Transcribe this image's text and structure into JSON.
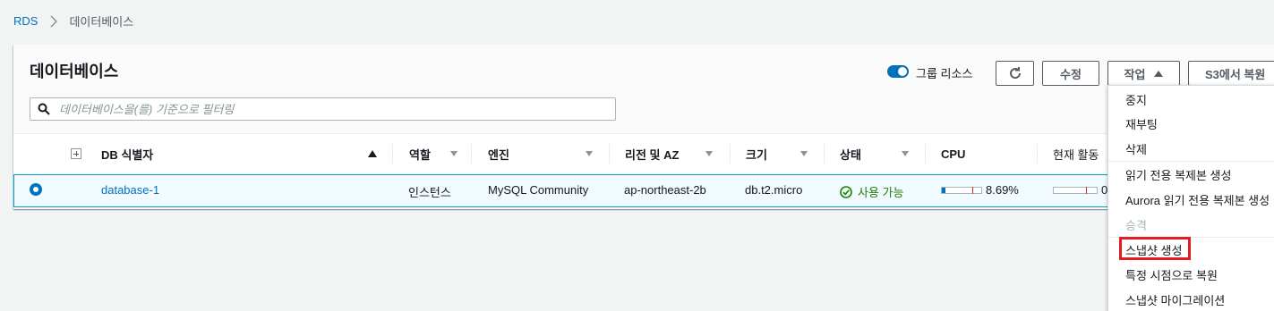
{
  "breadcrumb": {
    "root": "RDS",
    "current": "데이터베이스"
  },
  "panel": {
    "title": "데이터베이스",
    "group_toggle_label": "그룹 리소스",
    "buttons": {
      "edit": "수정",
      "actions": "작업",
      "restore_s3": "S3에서 복원"
    },
    "search_placeholder": "데이터베이스을(를) 기준으로 필터링"
  },
  "table": {
    "headers": {
      "db_identifier": "DB 식별자",
      "role": "역할",
      "engine": "엔진",
      "region": "리전 및 AZ",
      "size": "크기",
      "status": "상태",
      "cpu": "CPU",
      "activity": "현재 활동"
    },
    "rows": [
      {
        "db_identifier": "database-1",
        "role": "인스턴스",
        "engine": "MySQL Community",
        "region": "ap-northeast-2b",
        "size": "db.t2.micro",
        "status": "사용 가능",
        "cpu": "8.69%",
        "cpu_value": 8.69,
        "activity": "0"
      }
    ]
  },
  "actions_menu": {
    "items": [
      "중지",
      "재부팅",
      "삭제",
      "읽기 전용 복제본 생성",
      "Aurora 읽기 전용 복제본 생성",
      "승격",
      "스냅샷 생성",
      "특정 시점으로 복원",
      "스냅샷 마이그레이션"
    ],
    "disabled": [
      "승격"
    ],
    "highlighted": "스냅샷 생성"
  },
  "colors": {
    "accent": "#0073bb",
    "success": "#1d8102",
    "highlight": "#e31b23"
  }
}
